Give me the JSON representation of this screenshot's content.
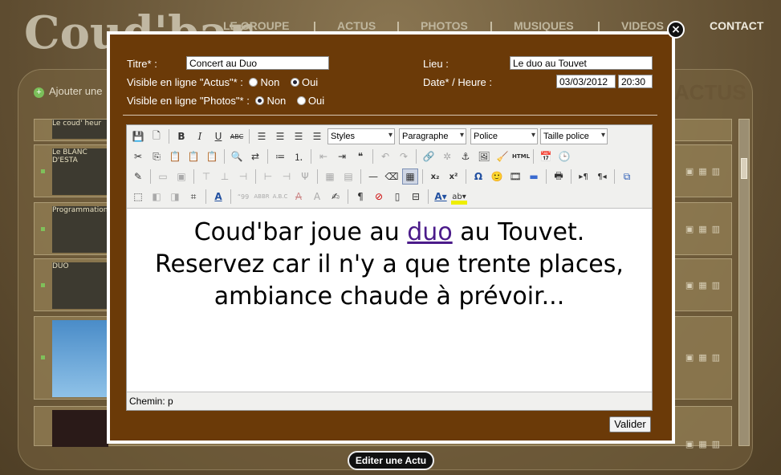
{
  "nav": {
    "logo": "Coud'bar",
    "items": [
      "LE GROUPE",
      "ACTUS",
      "PHOTOS",
      "MUSIQUES",
      "VIDEOS",
      "CONTACT"
    ]
  },
  "page": {
    "add_label": "Ajouter une",
    "section_title": "ACTUS",
    "footer_button": "Editer une Actu"
  },
  "list": {
    "thumbs": [
      "Le coud' heur",
      "Le BLANC D'ESTA",
      "Programmation",
      "DUO",
      "",
      ""
    ]
  },
  "form": {
    "title_label": "Titre* :",
    "title_value": "Concert au Duo",
    "lieu_label": "Lieu :",
    "lieu_value": "Le duo au Touvet",
    "visible_actus_label": "Visible en ligne \"Actus\"* :",
    "visible_photos_label": "Visible en ligne \"Photos\"* :",
    "non": "Non",
    "oui": "Oui",
    "visible_actus": "oui",
    "visible_photos": "non",
    "date_label": "Date* / Heure :",
    "date_value": "03/03/2012",
    "time_value": "20:30",
    "submit": "Valider",
    "close": "×"
  },
  "editor": {
    "styles": "Styles",
    "format": "Paragraphe",
    "font": "Police",
    "size": "Taille police",
    "content_before": "Coud'bar joue au ",
    "content_link": "duo",
    "content_after": " au Touvet.",
    "content_line2": "Reservez car il n'y a que trente places,",
    "content_line3": "ambiance chaude à prévoir...",
    "path_label": "Chemin: p",
    "html_label": "HTML"
  }
}
